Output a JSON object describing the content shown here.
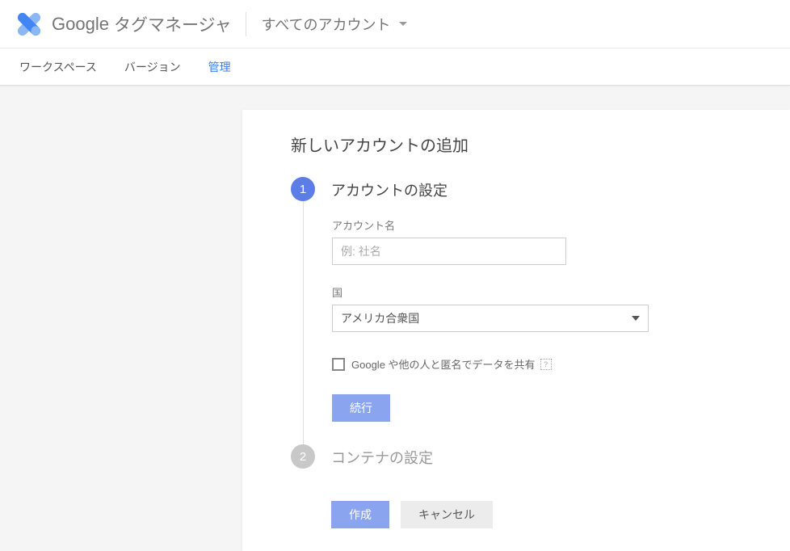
{
  "header": {
    "brand_google": "Google",
    "brand_product": "タグマネージャ",
    "account_selector": "すべてのアカウント"
  },
  "tabs": {
    "workspace": "ワークスペース",
    "version": "バージョン",
    "admin": "管理"
  },
  "main": {
    "title": "新しいアカウントの追加",
    "step1": {
      "number": "1",
      "title": "アカウントの設定",
      "account_name_label": "アカウント名",
      "account_name_placeholder": "例: 社名",
      "country_label": "国",
      "country_value": "アメリカ合衆国",
      "share_checkbox_label": "Google や他の人と匿名でデータを共有",
      "help_icon": "?",
      "continue_button": "続行"
    },
    "step2": {
      "number": "2",
      "title": "コンテナの設定"
    },
    "actions": {
      "create": "作成",
      "cancel": "キャンセル"
    }
  }
}
